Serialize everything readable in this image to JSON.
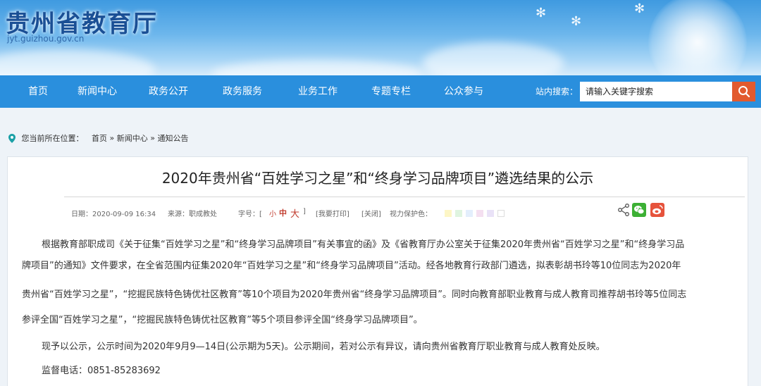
{
  "header": {
    "title": "贵州省教育厅",
    "url": "jyt.guizhou.gov.cn"
  },
  "nav": {
    "items": [
      "首页",
      "新闻中心",
      "政务公开",
      "政务服务",
      "业务工作",
      "专题专栏",
      "公众参与"
    ],
    "search_label": "站内搜索：",
    "search_placeholder": "请输入关键字搜索"
  },
  "breadcrumb": {
    "prefix": "您当前所在位置：",
    "items": [
      "首页",
      "新闻中心",
      "通知公告"
    ],
    "separator": "»"
  },
  "article": {
    "title": "2020年贵州省“百姓学习之星”和“终身学习品牌项目”遴选结果的公示",
    "meta": {
      "date": "日期：2020-09-09 16:34",
      "source": "来源：职成教处",
      "fontsize_label": "字号：[",
      "small": "小",
      "mid": "中",
      "big": "大",
      "close_bracket": "]",
      "print": "[我要打印]",
      "close": "[关闭]",
      "eye_care": "视力保护色："
    },
    "eye_colors": [
      "#fdf6c6",
      "#dff4e0",
      "#e3eefc",
      "#f4dff0",
      "#e9e2f7",
      "#ffffff"
    ],
    "paragraphs": [
      "根据教育部职成司《关于征集“百姓学习之星”和“终身学习品牌项目”有关事宜的函》及《省教育厅办公室关于征集2020年贵州省“百姓学习之星”和“终身学习品",
      "牌项目”的通知》文件要求，在全省范围内征集2020年“百姓学习之星”和“终身学习品牌项目”活动。经各地教育行政部门遴选，拟表彰胡书玲等10位同志为2020年",
      "贵州省“百姓学习之星”，“挖掘民族特色铸优社区教育”等10个项目为2020年贵州省“终身学习品牌项目”。同时向教育部职业教育与成人教育司推荐胡书玲等5位同志",
      "参评全国“百姓学习之星”，“挖掘民族特色铸优社区教育”等5个项目参评全国“终身学习品牌项目”。",
      "现予以公示，公示时间为2020年9月9—14日(公示期为5天)。公示期间，若对公示有异议，请向贵州省教育厅职业教育与成人教育处反映。",
      "监督电话：0851-85283692"
    ]
  },
  "colors": {
    "nav_bg": "#2a8fdd",
    "search_btn": "#e25a2e",
    "wechat": "#3cb034",
    "weibo": "#e6533c"
  }
}
